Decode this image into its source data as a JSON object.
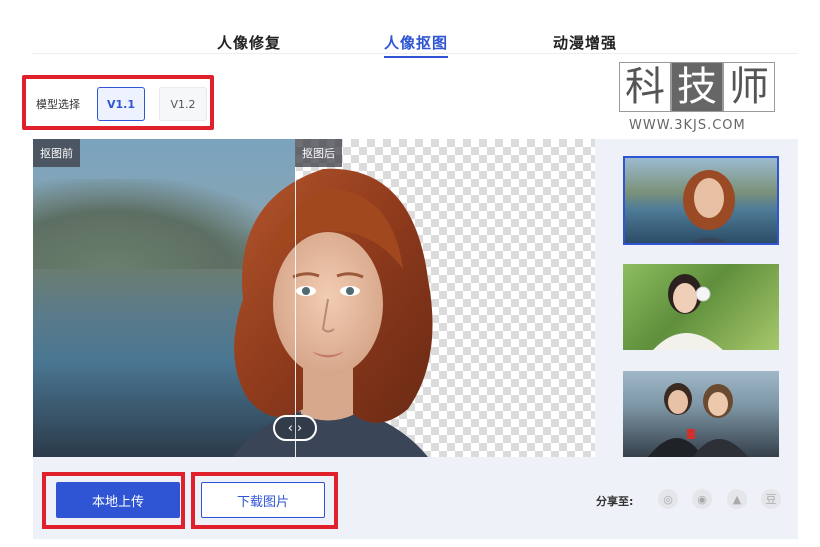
{
  "tabs": [
    {
      "label": "人像修复",
      "active": false
    },
    {
      "label": "人像抠图",
      "active": true
    },
    {
      "label": "动漫增强",
      "active": false
    }
  ],
  "model_select": {
    "label": "模型选择",
    "options": [
      "V1.1",
      "V1.2"
    ],
    "selected": "V1.1"
  },
  "watermark": {
    "chars": [
      "科",
      "技",
      "师"
    ],
    "url": "WWW.3KJS.COM"
  },
  "viewer": {
    "before_tag": "抠图前",
    "after_tag": "抠图后",
    "handle_left": "‹",
    "handle_right": "›"
  },
  "actions": {
    "upload_label": "本地上传",
    "download_label": "下载图片"
  },
  "share": {
    "label": "分享至:",
    "icons": [
      {
        "name": "wechat-moments-icon",
        "glyph": "◎"
      },
      {
        "name": "weibo-icon",
        "glyph": "◉"
      },
      {
        "name": "qq-icon",
        "glyph": "▲"
      },
      {
        "name": "douban-icon",
        "glyph": "豆"
      }
    ]
  },
  "colors": {
    "accent": "#2f55d4",
    "highlight_box": "#e0202a"
  }
}
